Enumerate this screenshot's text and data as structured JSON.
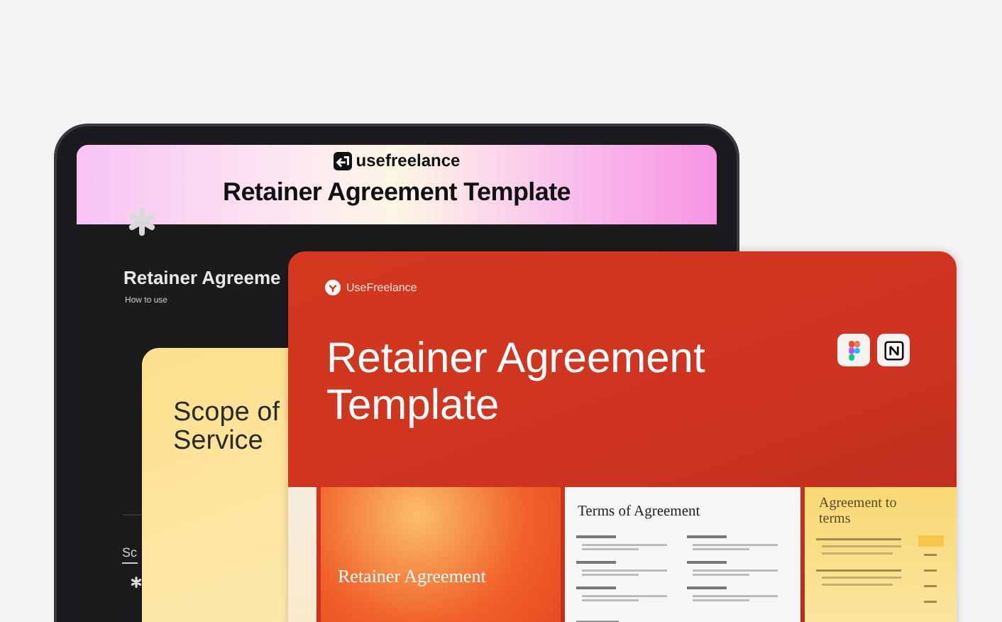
{
  "tablet": {
    "brand": "usefreelance",
    "banner_title": "Retainer Agreement Template",
    "page_title": "Retainer Agreeme",
    "subtitle": "How to use",
    "section_label": "Sc",
    "card": {
      "title": "Scope of Service"
    }
  },
  "cover": {
    "brand": "UseFreelance",
    "title": "Retainer Agreement Template",
    "tools": [
      {
        "kind": "figma"
      },
      {
        "kind": "notion"
      }
    ],
    "pages": [
      {
        "kind": "cover",
        "title": "Retainer Agreement"
      },
      {
        "kind": "terms",
        "title": "Terms of Agreement"
      },
      {
        "kind": "sidebar",
        "title": "Agreement to terms"
      }
    ]
  }
}
